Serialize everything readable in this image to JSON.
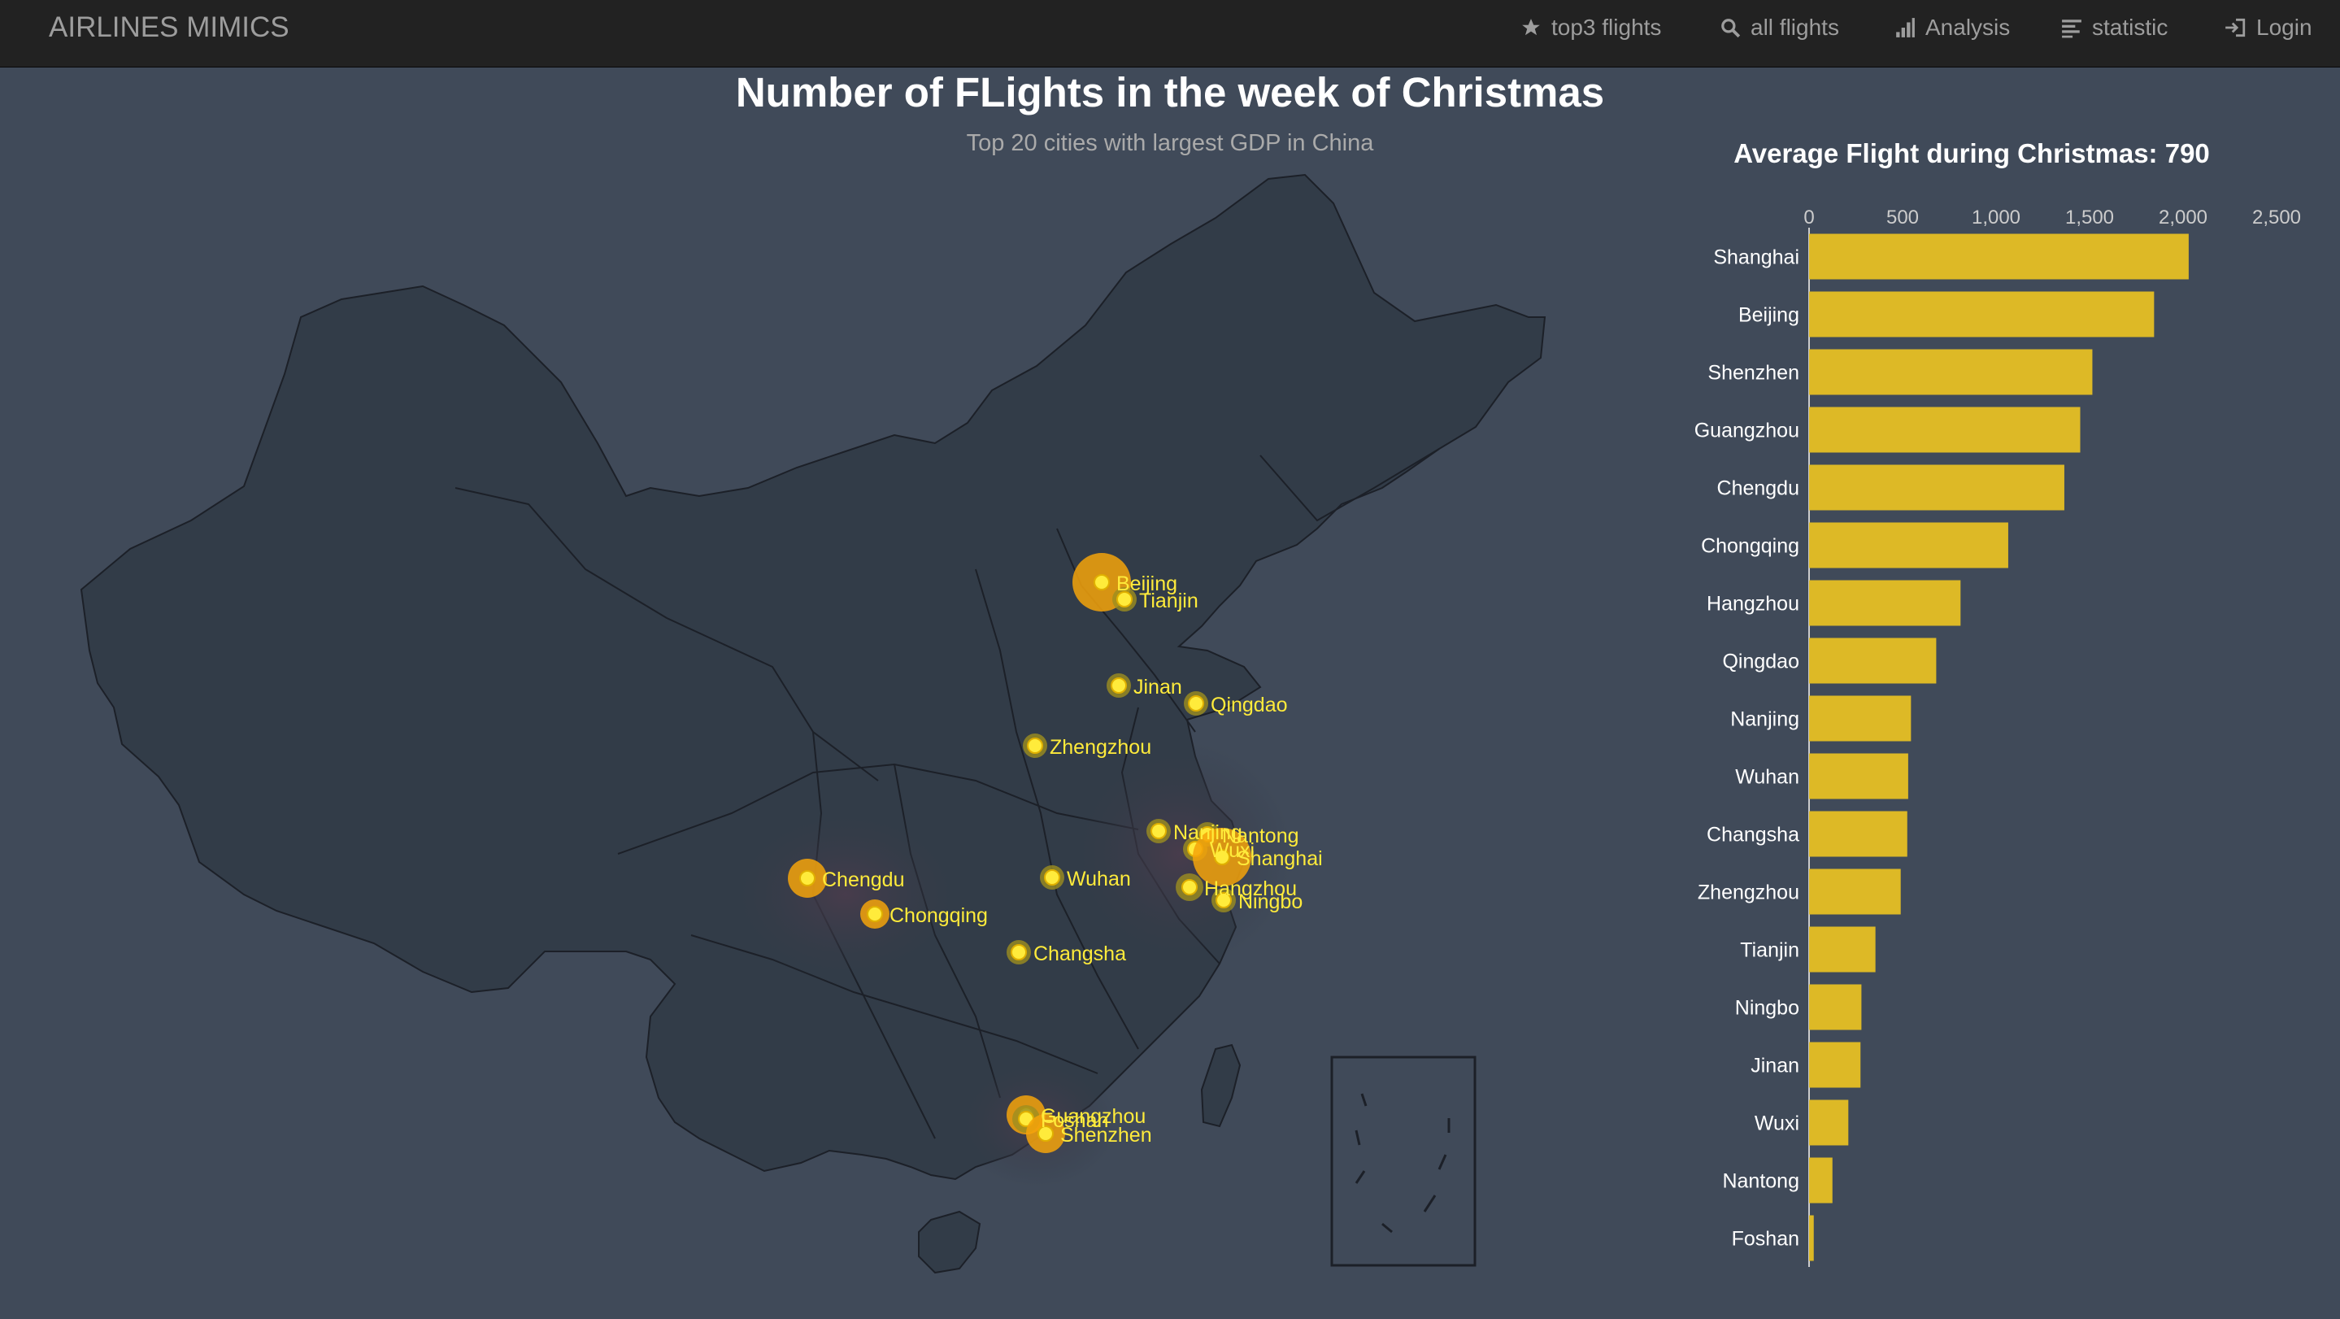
{
  "navbar": {
    "brand": "AIRLINES MIMICS",
    "items": [
      {
        "label": "top3 flights",
        "icon": "star-icon"
      },
      {
        "label": "all flights",
        "icon": "search-icon"
      },
      {
        "label": "Analysis",
        "icon": "signal-icon"
      },
      {
        "label": "statistic",
        "icon": "align-left-icon"
      },
      {
        "label": "Login",
        "icon": "log-in-icon"
      }
    ]
  },
  "map": {
    "title": "Number of FLights in the week of Christmas",
    "subtitle": "Top 20 cities with largest GDP in China",
    "cities": [
      "Beijing",
      "Tianjin",
      "Jinan",
      "Qingdao",
      "Zhengzhou",
      "Nanjing",
      "Nantong",
      "Wuxi",
      "Shanghai",
      "Hangzhou",
      "Ningbo",
      "Chengdu",
      "Chongqing",
      "Wuhan",
      "Changsha",
      "Guangzhou",
      "Foshan",
      "Shenzhen"
    ],
    "colors": {
      "background": "#404a59",
      "land": "#323c48",
      "border": "#111111",
      "point": "#ffeb3b",
      "large_point": "#f4a30a"
    }
  },
  "bar_chart_title": "Average Flight during Christmas: 790",
  "chart_data": {
    "type": "bar",
    "orientation": "horizontal",
    "title": "Average Flight during Christmas: 790",
    "xlabel": "",
    "ylabel": "",
    "xlim": [
      0,
      2500
    ],
    "x_ticks": [
      "0",
      "500",
      "1,000",
      "1,500",
      "2,000",
      "2,500"
    ],
    "categories": [
      "Shanghai",
      "Beijing",
      "Shenzhen",
      "Guangzhou",
      "Chengdu",
      "Chongqing",
      "Hangzhou",
      "Qingdao",
      "Nanjing",
      "Wuhan",
      "Changsha",
      "Zhengzhou",
      "Tianjin",
      "Ningbo",
      "Jinan",
      "Wuxi",
      "Nantong",
      "Foshan"
    ],
    "values": [
      2030,
      1845,
      1515,
      1450,
      1365,
      1065,
      810,
      680,
      545,
      530,
      525,
      490,
      355,
      280,
      275,
      210,
      125,
      25
    ],
    "bar_color": "#ddb926",
    "grid": false
  }
}
